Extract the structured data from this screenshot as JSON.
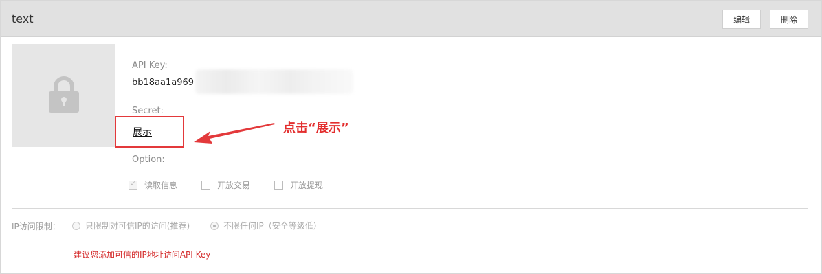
{
  "header": {
    "title": "text",
    "edit_label": "编辑",
    "delete_label": "删除"
  },
  "api": {
    "api_key_label": "API Key:",
    "api_key_value": "bb18aa1a969",
    "secret_label": "Secret:",
    "secret_link": "展示",
    "option_label": "Option:"
  },
  "annotation": {
    "text": "点击“展示”",
    "color": "#e32e2e"
  },
  "options": [
    {
      "label": "读取信息",
      "checked": true
    },
    {
      "label": "开放交易",
      "checked": false
    },
    {
      "label": "开放提现",
      "checked": false
    }
  ],
  "ip": {
    "label": "IP访问限制：",
    "option1": "只限制对可信IP的访问(推荐)",
    "option2": "不限任何IP（安全等级低）",
    "selected": "option2",
    "hint": "建议您添加可信的IP地址访问API Key"
  },
  "icons": [
    "lock-icon",
    "arrow-icon",
    "check-icon"
  ],
  "colors": {
    "accent_red": "#e3393b",
    "header_bg": "#e1e1e1"
  }
}
